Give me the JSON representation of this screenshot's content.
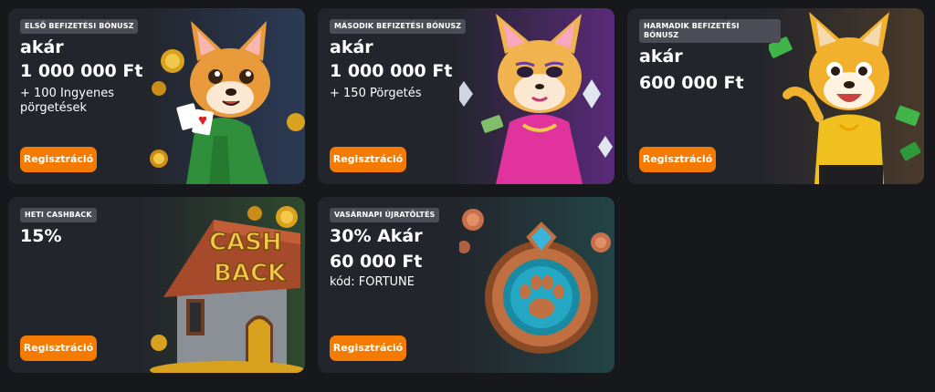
{
  "cards": [
    {
      "badge": "ELSŐ BEFIZETÉSI BÓNUSZ",
      "line1": "akár",
      "line2": "1 000 000 Ft",
      "extra1": "+ 100 Ingyenes",
      "extra2": "pörgetések",
      "button": "Regisztráció"
    },
    {
      "badge": "MÁSODIK BEFIZETÉSI BÓNUSZ",
      "line1": "akár",
      "line2": "1 000 000 Ft",
      "extra1": "+ 150 Pörgetés",
      "button": "Regisztráció"
    },
    {
      "badge1": "HARMADIK BEFIZETÉSI",
      "badge2": "BÓNUSZ",
      "line1": "akár",
      "line2": "600 000 Ft",
      "button": "Regisztráció"
    },
    {
      "badge": "HETI CASHBACK",
      "line1": "15%",
      "art_text1": "CASH",
      "art_text2": "BACK",
      "button": "Regisztráció"
    },
    {
      "badge": "VASÁRNAPI ÚJRATÖLTÉS",
      "line1": "30% Akár",
      "line2": "60 000 Ft",
      "extra1": "kód: FORTUNE",
      "button": "Regisztráció"
    }
  ],
  "colors": {
    "background": "#17181c",
    "card": "#23252c",
    "button": "#f47b00",
    "badge": "#4b4e57"
  }
}
